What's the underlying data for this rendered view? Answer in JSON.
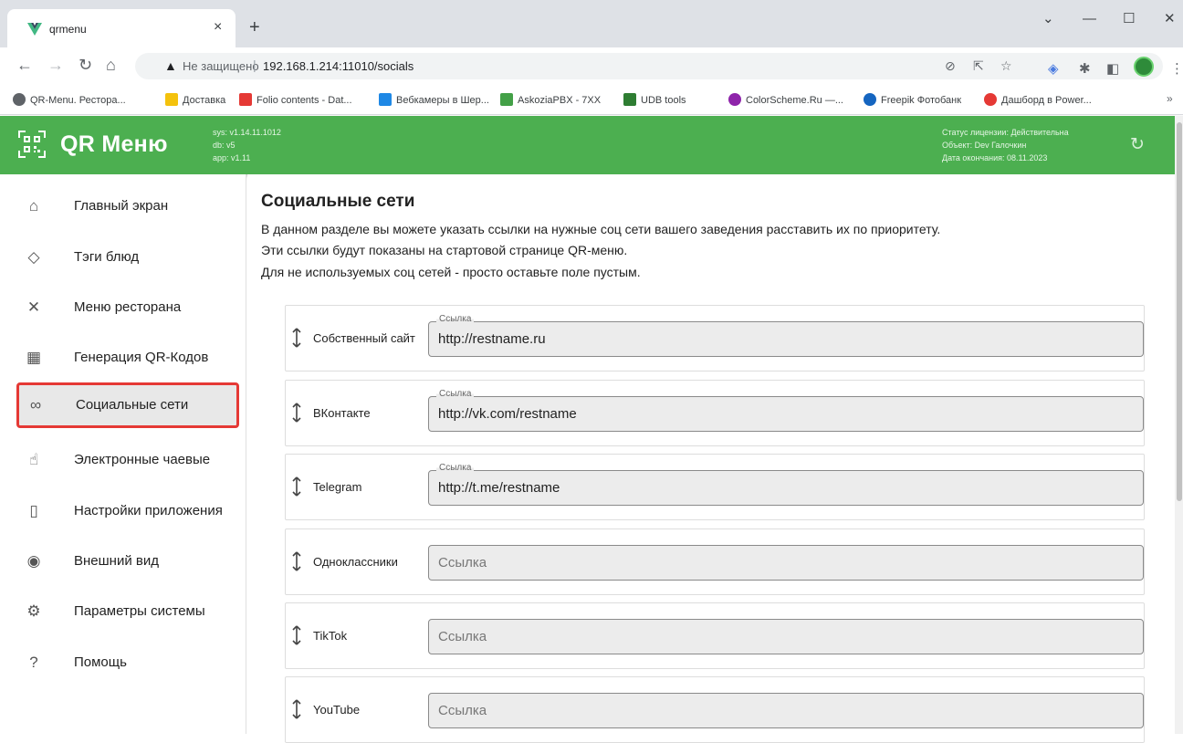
{
  "browser": {
    "tab_title": "qrmenu",
    "tab_close": "×",
    "new_tab": "+",
    "controls": {
      "minimize": "—",
      "maximize": "☐",
      "close": "✕",
      "dropdown": "⌄"
    },
    "not_secure": "Не защищено",
    "url": "192.168.1.214:11010/socials",
    "bookmarks": [
      {
        "label": "QR-Menu. Рестора...",
        "color": "#5f6368"
      },
      {
        "label": "Доставка",
        "color": "#f4c20d"
      },
      {
        "label": "Folio contents - Dat...",
        "color": "#e53935"
      },
      {
        "label": "Вебкамеры в Шер...",
        "color": "#1e88e5"
      },
      {
        "label": "AskoziaPBX - 7XX",
        "color": "#43a047"
      },
      {
        "label": "UDB tools",
        "color": "#2e7d32"
      },
      {
        "label": "ColorScheme.Ru —...",
        "color": "#8e24aa"
      },
      {
        "label": "Freepik Фотобанк",
        "color": "#1565c0"
      },
      {
        "label": "Дашборд в Power...",
        "color": "#e53935"
      }
    ],
    "bookmarks_more": "»"
  },
  "header": {
    "logo": "QR Меню",
    "sys": "sys: v1.14.11.1012",
    "db": "db: v5",
    "app": "app: v1.11",
    "license_status": "Статус лицензии: Действительна",
    "license_object": "Объект: Dev Галочкин",
    "license_end": "Дата окончания: 08.11.2023",
    "accent": "#4caf50"
  },
  "sidebar": {
    "items": [
      {
        "label": "Главный экран",
        "icon": "home-icon"
      },
      {
        "label": "Тэги блюд",
        "icon": "tag-icon"
      },
      {
        "label": "Меню ресторана",
        "icon": "cutlery-icon"
      },
      {
        "label": "Генерация QR-Кодов",
        "icon": "qr-icon"
      },
      {
        "label": "Социальные сети",
        "icon": "link-icon"
      },
      {
        "label": "Электронные чаевые",
        "icon": "tips-icon"
      },
      {
        "label": "Настройки приложения",
        "icon": "phone-settings-icon"
      },
      {
        "label": "Внешний вид",
        "icon": "eye-icon"
      },
      {
        "label": "Параметры системы",
        "icon": "gear-icon"
      },
      {
        "label": "Помощь",
        "icon": "help-icon"
      }
    ]
  },
  "main": {
    "title": "Социальные сети",
    "desc1": "В данном разделе вы можете указать ссылки на нужные соц сети вашего заведения расставить их по приоритету.",
    "desc2": "Эти ссылки будут показаны на стартовой странице QR-меню.",
    "desc3": "Для не используемых соц сетей - просто оставьте поле пустым.",
    "field_label": "Ссылка",
    "socials": [
      {
        "name": "Собственный сайт",
        "value": "http://restname.ru"
      },
      {
        "name": "ВКонтакте",
        "value": "http://vk.com/restname"
      },
      {
        "name": "Telegram",
        "value": "http://t.me/restname"
      },
      {
        "name": "Одноклассники",
        "value": ""
      },
      {
        "name": "TikTok",
        "value": ""
      },
      {
        "name": "YouTube",
        "value": ""
      }
    ]
  }
}
